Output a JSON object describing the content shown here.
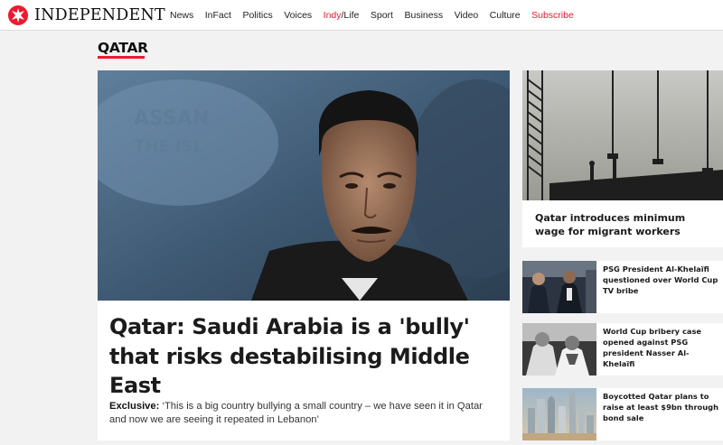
{
  "header": {
    "logo_text": "INDEPENDENT",
    "nav": [
      "News",
      "InFact",
      "Politics",
      "Voices",
      "Sport",
      "Business",
      "Video",
      "Culture"
    ],
    "indy_life": {
      "part1": "Indy",
      "part2": "/Life"
    },
    "subscribe": "Subscribe"
  },
  "section": {
    "title": "QATAR"
  },
  "lead": {
    "title": "Qatar: Saudi Arabia is a 'bully' that risks destabilising Middle East",
    "standfirst_label": "Exclusive:",
    "standfirst_text": "‘This is a big country bullying a small country – we have seen it in Qatar and now we are seeing it repeated in Lebanon’"
  },
  "side_main": {
    "title": "Qatar introduces minimum wage for migrant workers"
  },
  "side_items": [
    {
      "title": "PSG President Al-Khelaïfi questioned over World Cup TV bribe"
    },
    {
      "title": "World Cup bribery case opened against PSG president Nasser Al-Khelaïfi"
    },
    {
      "title": "Boycotted Qatar plans to raise at least $9bn through bond sale"
    }
  ],
  "colors": {
    "accent": "#ec1a2e",
    "background": "#f2f2f2"
  }
}
